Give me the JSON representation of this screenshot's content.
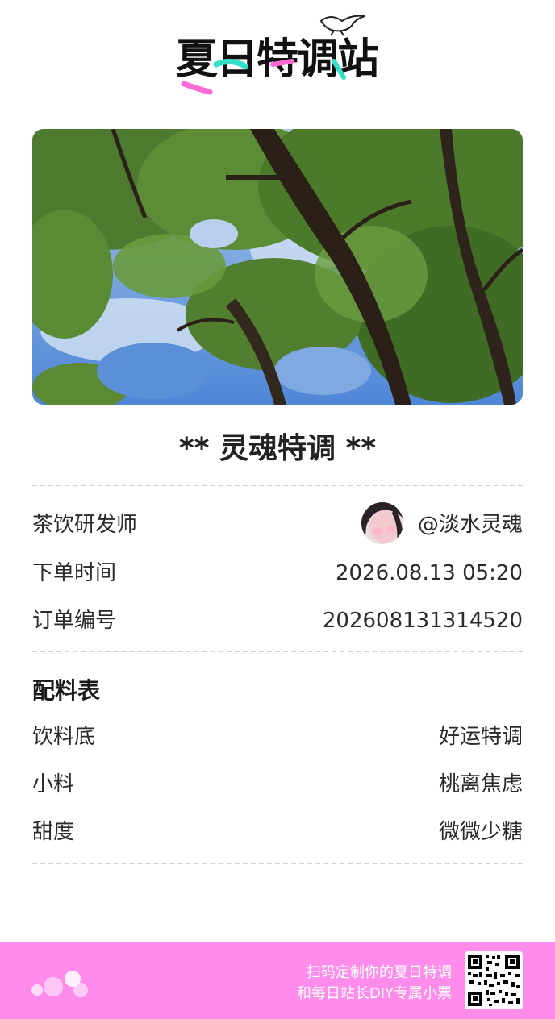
{
  "header": {
    "logo_text": "夏日特调站",
    "logo_icon": "seagull-icon"
  },
  "photo": {
    "icon": "tree-canopy-photo"
  },
  "ticket": {
    "title": "** 灵魂特调 **",
    "rows": [
      {
        "label": "茶饮研发师",
        "value": "@淡水灵魂"
      },
      {
        "label": "下单时间",
        "value": "2026.08.13  05:20"
      },
      {
        "label": "订单编号",
        "value": "202608131314520"
      }
    ]
  },
  "recipe": {
    "title": "配料表",
    "rows": [
      {
        "label": "饮料底",
        "value": "好运特调"
      },
      {
        "label": "小料",
        "value": "桃离焦虑"
      },
      {
        "label": "甜度",
        "value": "微微少糖"
      }
    ]
  },
  "footer": {
    "line1": "扫码定制你的夏日特调",
    "line2": "和每日站长DIY专属小票",
    "qr_icon": "qr-code-icon"
  },
  "colors": {
    "footer_bg": "#ff8ceb",
    "accent_teal": "#36e0c8",
    "accent_pink": "#ff6bd5"
  }
}
